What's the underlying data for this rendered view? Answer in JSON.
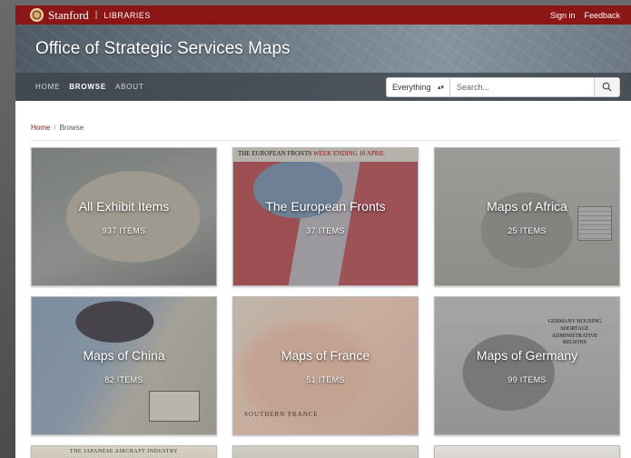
{
  "topbar": {
    "logo_text": "Stanford",
    "logo_sub": "LIBRARIES",
    "links": [
      "Sign in",
      "Feedback"
    ]
  },
  "masthead": {
    "title": "Office of Strategic Services Maps",
    "nav": [
      "HOME",
      "BROWSE",
      "ABOUT"
    ],
    "active_nav": "BROWSE",
    "search": {
      "scope": "Everything",
      "placeholder": "Search..."
    }
  },
  "breadcrumb": {
    "home": "Home",
    "separator": "/",
    "current": "Browse"
  },
  "cards": [
    {
      "label": "All Exhibit Items",
      "count": "937 ITEMS"
    },
    {
      "label": "The European Fronts",
      "count": "37 ITEMS",
      "map_header": "THE EUROPEAN FRONTS",
      "map_header_red": "WEEK ENDING 10 APRIL"
    },
    {
      "label": "Maps of Africa",
      "count": "25 ITEMS"
    },
    {
      "label": "Maps of China",
      "count": "82 ITEMS"
    },
    {
      "label": "Maps of France",
      "count": "51 ITEMS",
      "map_caption": "SOUTHERN FRANCE"
    },
    {
      "label": "Maps of Germany",
      "count": "99 ITEMS",
      "map_caption": "GERMANY HOUSING SHORTAGE ADMINISTRATIVE REGIONS"
    },
    {
      "map_header": "THE JAPANESE AIRCRAFT INDUSTRY"
    }
  ],
  "colors": {
    "brand": "#8c1515",
    "link": "#8c1515"
  }
}
